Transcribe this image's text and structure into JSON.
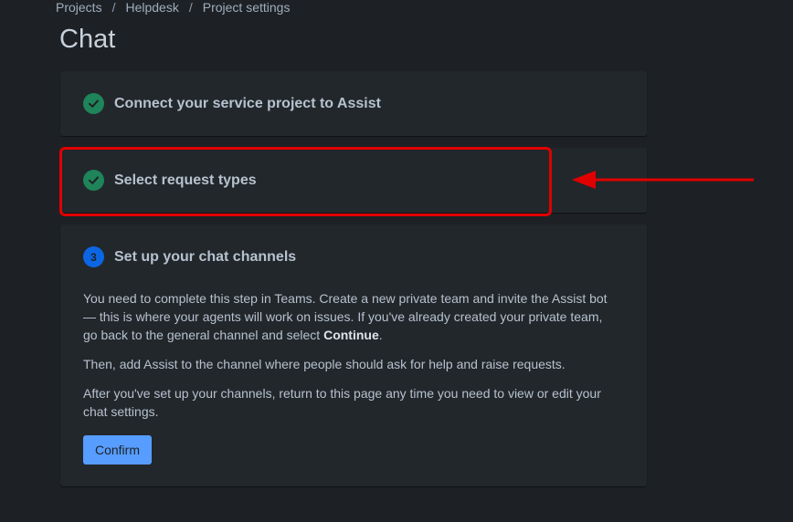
{
  "breadcrumb": {
    "items": [
      "Projects",
      "Helpdesk",
      "Project settings"
    ],
    "separator": "/"
  },
  "page": {
    "title": "Chat"
  },
  "steps": [
    {
      "title": "Connect your service project to Assist",
      "status": "complete",
      "icon": "check-circle-icon"
    },
    {
      "title": "Select request types",
      "status": "complete",
      "icon": "check-circle-icon"
    },
    {
      "number": "3",
      "title": "Set up your chat channels",
      "status": "current",
      "paragraph1_part1": "You need to complete this step in Teams. Create a new private team and invite the Assist bot — this is where your agents will work on issues. If you've already created your private team, go back to the general channel and select ",
      "paragraph1_bold": "Continue",
      "paragraph1_end": ".",
      "paragraph2": "Then, add Assist to the channel where people should ask for help and raise requests.",
      "paragraph3": "After you've set up your channels, return to this page any time you need to view or edit your chat settings.",
      "confirm_label": "Confirm"
    }
  ],
  "colors": {
    "background": "#1d2125",
    "card": "#22272b",
    "success": "#1f845a",
    "current": "#0c66e4",
    "primary_button": "#579dff",
    "annotation": "#e00000"
  },
  "annotation": {
    "type": "highlight-with-arrow",
    "target": "Select request types"
  }
}
